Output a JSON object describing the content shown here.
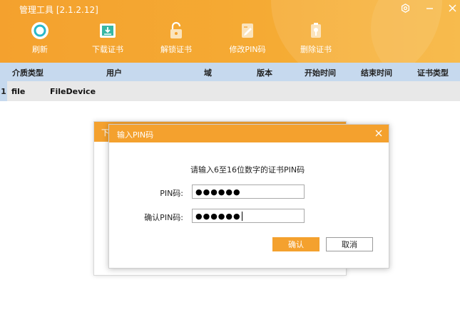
{
  "app": {
    "title": "管理工具 [2.1.2.12]"
  },
  "toolbar": {
    "refresh_label": "刷新",
    "download_label": "下载证书",
    "unlock_label": "解锁证书",
    "change_pin_label": "修改PIN码",
    "delete_label": "删除证书"
  },
  "table": {
    "columns": [
      "介质类型",
      "用户",
      "域",
      "版本",
      "开始时间",
      "结束时间",
      "证书类型"
    ],
    "rows": [
      {
        "num": "1",
        "media_type": "file",
        "user": "FileDevice",
        "domain": "",
        "version": "",
        "start": "",
        "end": "",
        "cert_type": ""
      }
    ]
  },
  "background_dialog": {
    "title": "下"
  },
  "pin_dialog": {
    "title": "输入PIN码",
    "prompt": "请输入6至16位数字的证书PIN码",
    "pin_label": "PIN码:",
    "pin_value": "●●●●●●",
    "confirm_label": "确认PIN码:",
    "confirm_value": "●●●●●●",
    "ok_label": "确认",
    "cancel_label": "取消"
  },
  "colors": {
    "accent": "#f4a12e",
    "table_header": "#c6d9ee",
    "row_bg": "#e8e8e8"
  }
}
